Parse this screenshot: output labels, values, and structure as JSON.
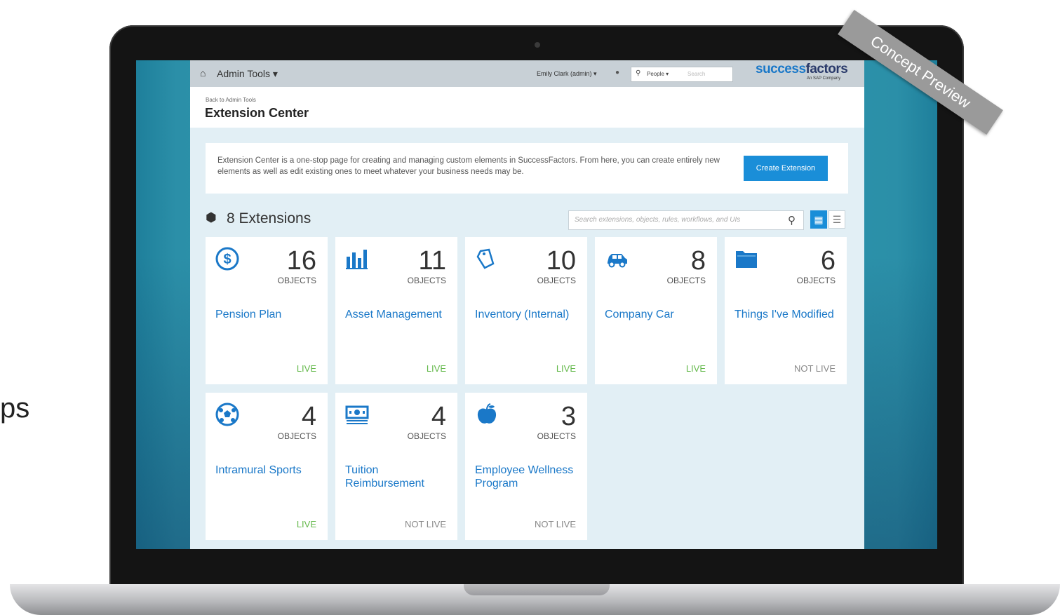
{
  "stray_text": "ps",
  "watermark": "Concept Preview",
  "topbar": {
    "admin_label": "Admin Tools ▾",
    "user_label": "Emily Clark (admin) ▾",
    "search_scope": "People ▾",
    "search_placeholder": "Search",
    "logo_a": "success",
    "logo_b": "factors",
    "logo_sub": "An SAP Company"
  },
  "header": {
    "back_link": "Back to Admin Tools",
    "title": "Extension Center"
  },
  "info": {
    "text": "Extension Center is a one-stop page for creating and managing custom elements in SuccessFactors. From here, you can create entirely new elements as well as edit existing ones to meet whatever your business needs may be.",
    "create_label": "Create Extension"
  },
  "extensions": {
    "count_label": "8 Extensions",
    "filter_placeholder": "Search extensions, objects, rules, workflows, and UIs"
  },
  "cards": [
    {
      "icon": "dollar-icon",
      "count": "16",
      "unit": "OBJECTS",
      "name": "Pension Plan",
      "status": "LIVE"
    },
    {
      "icon": "bar-chart-icon",
      "count": "11",
      "unit": "OBJECTS",
      "name": "Asset Management",
      "status": "LIVE"
    },
    {
      "icon": "tag-icon",
      "count": "10",
      "unit": "OBJECTS",
      "name": "Inventory (Internal)",
      "status": "LIVE"
    },
    {
      "icon": "car-icon",
      "count": "8",
      "unit": "OBJECTS",
      "name": "Company Car",
      "status": "LIVE"
    },
    {
      "icon": "folder-icon",
      "count": "6",
      "unit": "OBJECTS",
      "name": "Things I've Modified",
      "status": "NOT LIVE"
    },
    {
      "icon": "soccer-ball-icon",
      "count": "4",
      "unit": "OBJECTS",
      "name": "Intramural Sports",
      "status": "LIVE"
    },
    {
      "icon": "money-icon",
      "count": "4",
      "unit": "OBJECTS",
      "name": "Tuition Reimbursement",
      "status": "NOT LIVE"
    },
    {
      "icon": "apple-icon",
      "count": "3",
      "unit": "OBJECTS",
      "name": "Employee Wellness Program",
      "status": "NOT LIVE"
    }
  ],
  "colors": {
    "accent": "#1a8ed8",
    "link": "#1a78c8",
    "live": "#63b84a",
    "not_live": "#888888",
    "screen_bg": "#2e9cb2"
  }
}
